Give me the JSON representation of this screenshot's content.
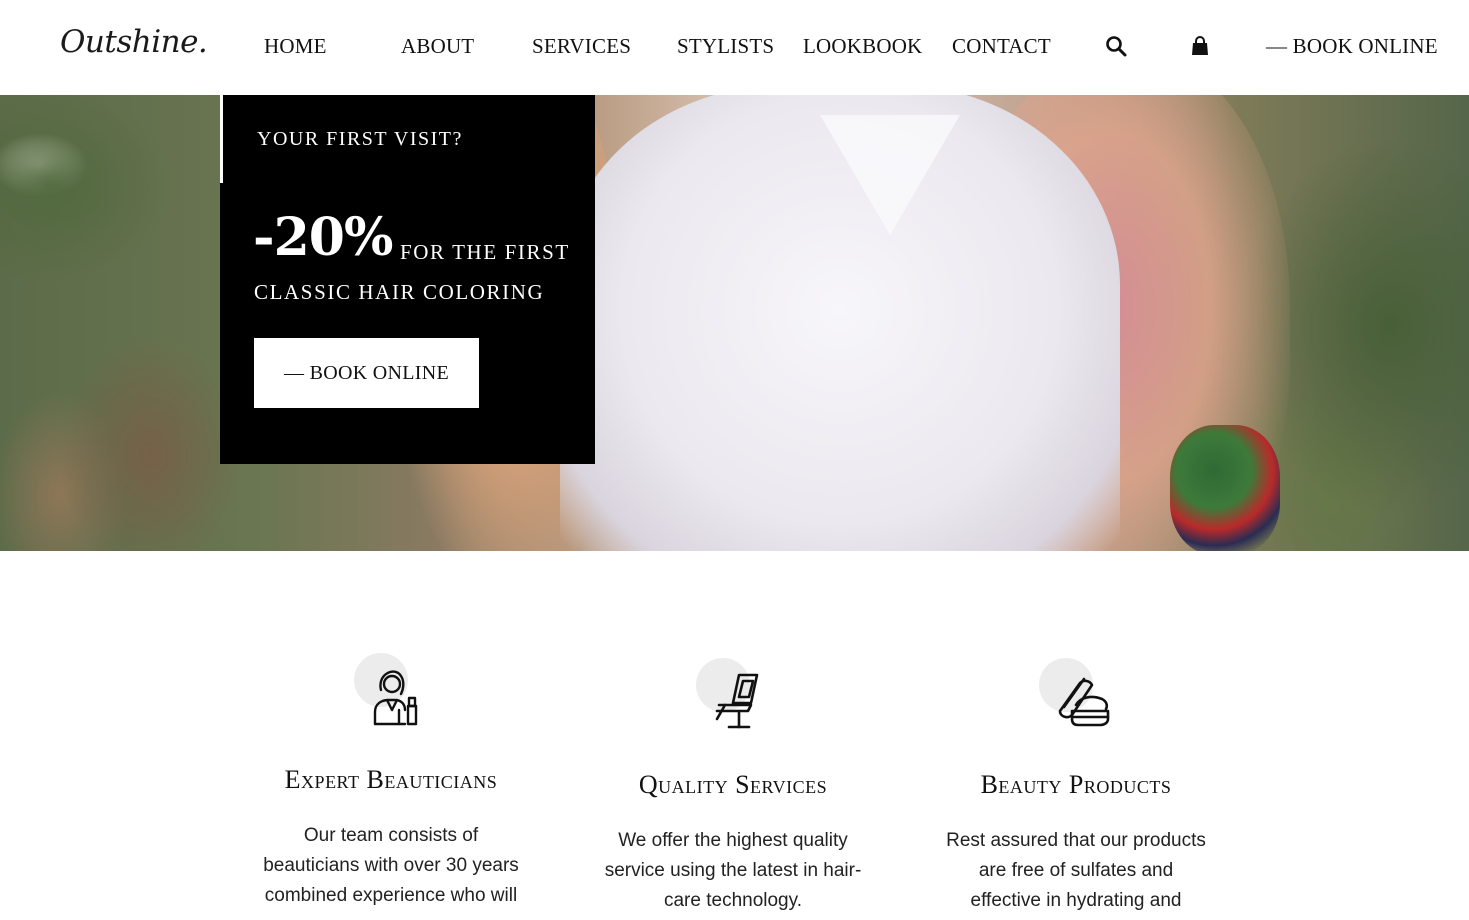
{
  "header": {
    "logo": "Outshine.",
    "nav": [
      "HOME",
      "ABOUT",
      "SERVICES",
      "STYLISTS",
      "LOOKBOOK",
      "CONTACT"
    ],
    "search_icon": "search-icon",
    "cart_icon": "shopping-bag-icon",
    "cta": "— BOOK ONLINE"
  },
  "hero": {
    "eyebrow": "YOUR FIRST VISIT?",
    "discount": "-20%",
    "offer_line1": "FOR THE FIRST",
    "offer_line2": "CLASSIC HAIR COLORING",
    "button": "— BOOK ONLINE"
  },
  "features": [
    {
      "icon": "beautician-icon",
      "title": "Expert Beauticians",
      "lines": [
        "Our team consists of",
        "beauticians with over 30 years",
        "combined experience who will"
      ]
    },
    {
      "icon": "salon-chair-icon",
      "title": "Quality Services",
      "lines": [
        "We offer the highest quality",
        "service using the latest in hair-",
        "care technology."
      ]
    },
    {
      "icon": "cream-jar-icon",
      "title": "Beauty Products",
      "lines": [
        "Rest assured that our products",
        "are free of sulfates and",
        "effective in hydrating and"
      ]
    }
  ],
  "colors": {
    "promo_background": "#000000",
    "icon_circle": "#ececec",
    "text": "#111111"
  }
}
